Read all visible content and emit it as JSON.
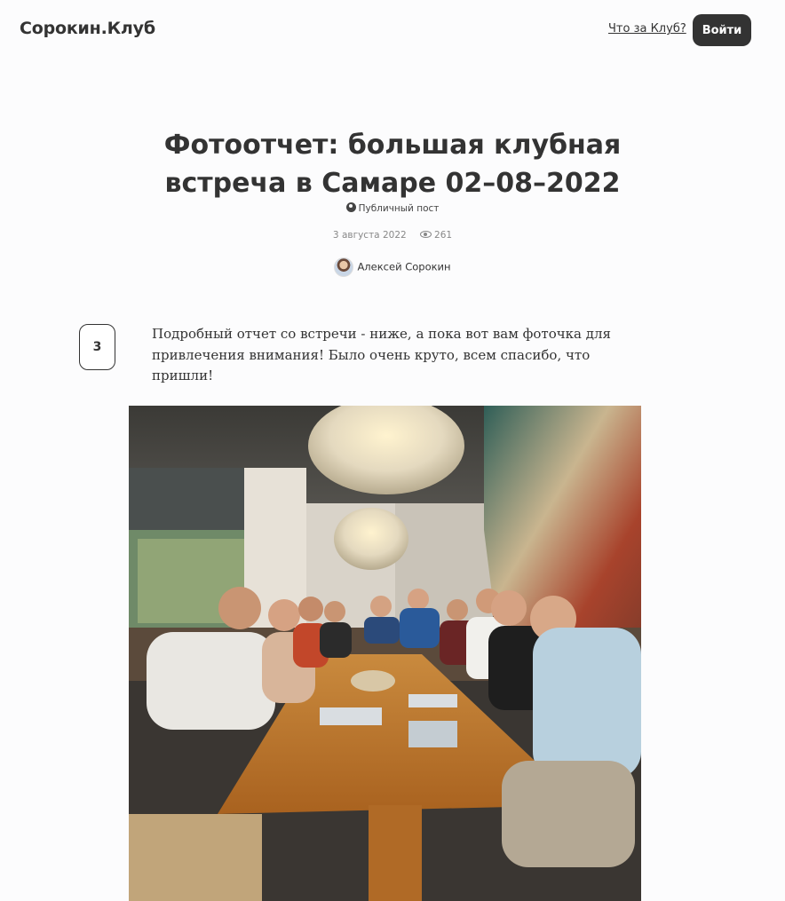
{
  "header": {
    "logo": "Сорокин.Клуб",
    "about_link": "Что за Клуб?",
    "login_button": "Войти"
  },
  "post": {
    "title": "Фотоотчет: большая клубная встреча в Самаре 02–08–2022",
    "visibility": "Публичный пост",
    "date": "3 августа 2022",
    "views": "261",
    "author": "Алексей Сорокин",
    "upvotes": "3",
    "text": "Подробный отчет со встречи - ниже, а пока вот вам фоточка для привлечения внимания! Было очень круто, всем спасибо, что пришли!"
  },
  "icons": {
    "visibility": "globe-icon",
    "views": "eye-icon"
  },
  "colors": {
    "text": "#333333",
    "muted": "#888888",
    "button_bg": "#333333"
  }
}
